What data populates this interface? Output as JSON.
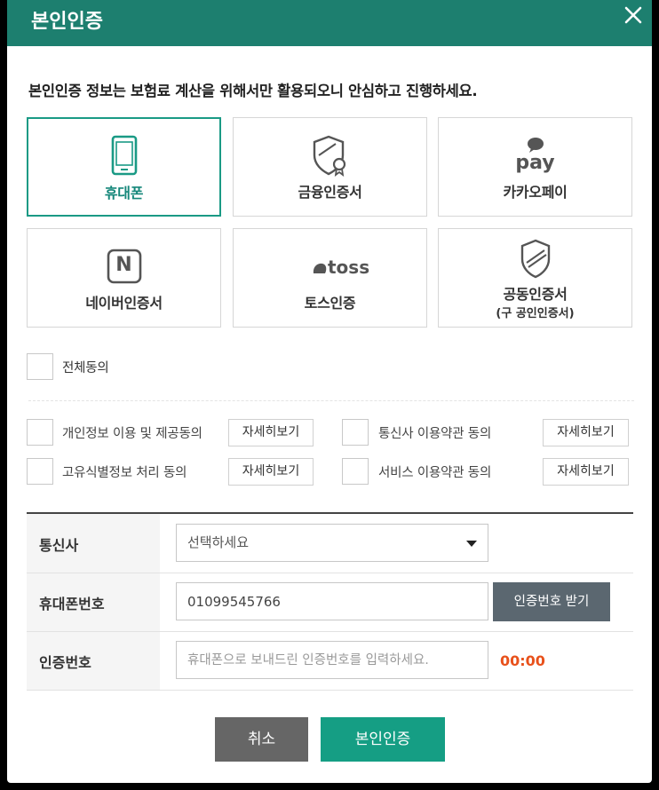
{
  "dialog": {
    "title": "본인인증",
    "close_icon": "close-icon",
    "notice": "본인인증 정보는 보험료 계산을 위해서만 활용되오니 안심하고 진행하세요."
  },
  "methods": [
    {
      "label": "휴대폰",
      "icon": "mobile-phone-icon",
      "selected": true
    },
    {
      "label": "금융인증서",
      "icon": "certificate-shield-icon",
      "selected": false
    },
    {
      "label": "카카오페이",
      "icon": "kakaopay-icon",
      "icon_text": "pay",
      "selected": false
    },
    {
      "label": "네이버인증서",
      "icon": "naver-icon",
      "icon_text": "N",
      "selected": false
    },
    {
      "label": "토스인증",
      "icon": "toss-icon",
      "icon_text": "toss",
      "selected": false
    },
    {
      "label": "공동인증서",
      "sub": "(구 공인인증서)",
      "icon": "shield-icon",
      "selected": false
    }
  ],
  "agreements": {
    "all_label": "전체동의",
    "items": [
      {
        "label": "개인정보 이용 및 제공동의",
        "detail": "자세히보기"
      },
      {
        "label": "통신사 이용약관 동의",
        "detail": "자세히보기"
      },
      {
        "label": "고유식별정보 처리 동의",
        "detail": "자세히보기"
      },
      {
        "label": "서비스 이용약관 동의",
        "detail": "자세히보기"
      }
    ]
  },
  "form": {
    "carrier_label": "통신사",
    "carrier_value": "선택하세요",
    "phone_label": "휴대폰번호",
    "phone_value": "01099545766",
    "request_button": "인증번호 받기",
    "code_label": "인증번호",
    "code_placeholder": "휴대폰으로 보내드린 인증번호를 입력하세요.",
    "timer": "00:00"
  },
  "buttons": {
    "cancel": "취소",
    "confirm": "본인인증"
  },
  "colors": {
    "header": "#1d7f6f",
    "accent": "#1a9a85",
    "confirm": "#159e84",
    "timer": "#e8511b"
  }
}
